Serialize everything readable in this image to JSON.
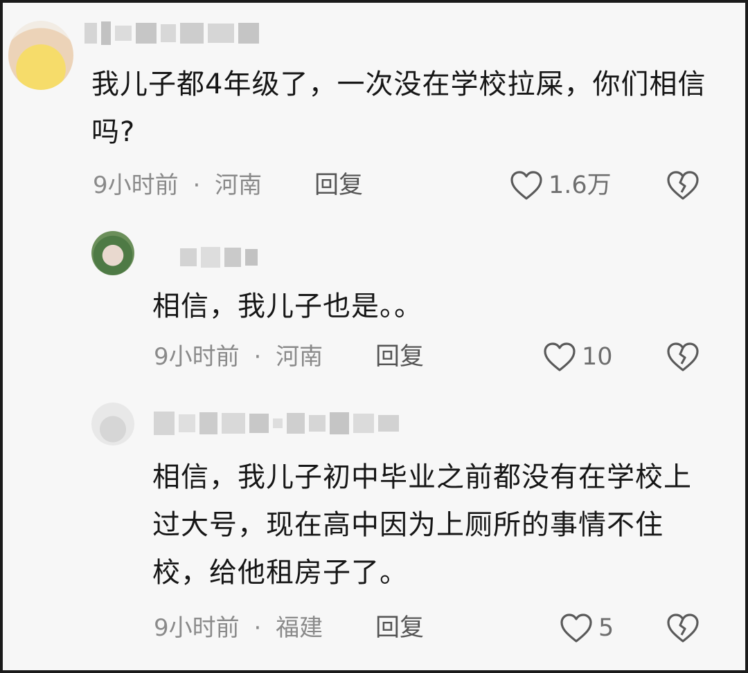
{
  "comments": [
    {
      "text": "我儿子都4年级了，一次没在学校拉屎，你们相信吗?",
      "time": "9小时前",
      "location": "河南",
      "reply_label": "回复",
      "likes": "1.6万"
    },
    {
      "text": "相信，我儿子也是。。",
      "time": "9小时前",
      "location": "河南",
      "reply_label": "回复",
      "likes": "10"
    },
    {
      "text": "相信，我儿子初中毕业之前都没有在学校上过大号，现在高中因为上厕所的事情不住校，给他租房子了。",
      "time": "9小时前",
      "location": "福建",
      "reply_label": "回复",
      "likes": "5"
    }
  ],
  "separator": "·",
  "icons": {
    "like": "heart-outline-icon",
    "dislike": "broken-heart-icon"
  }
}
